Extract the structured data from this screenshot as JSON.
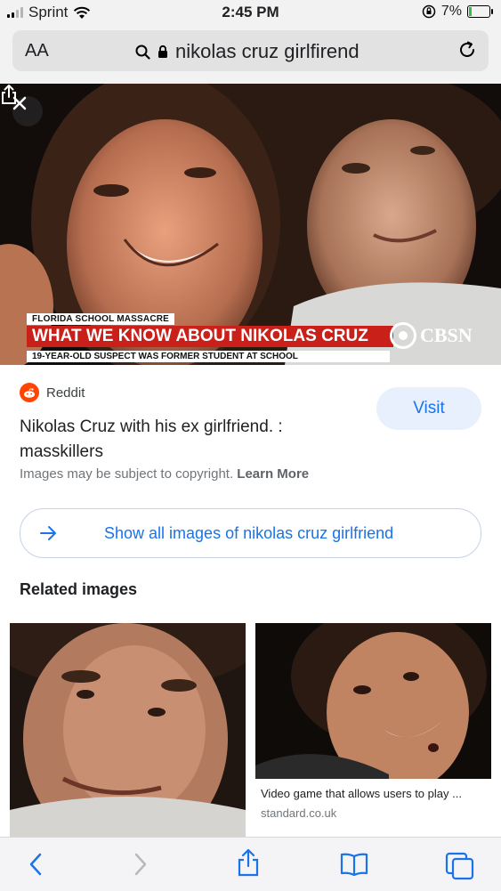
{
  "status_bar": {
    "carrier": "Sprint",
    "time": "2:45 PM",
    "battery_percent": "7%"
  },
  "url_bar": {
    "text_size_label": "AA",
    "query": "nikolas cruz girlfirend"
  },
  "hero": {
    "chyron_top": "FLORIDA SCHOOL MASSACRE",
    "chyron_main": "WHAT WE KNOW ABOUT NIKOLAS CRUZ",
    "chyron_sub": "19-YEAR-OLD SUSPECT WAS FORMER STUDENT AT SCHOOL",
    "network": "CBSN"
  },
  "result": {
    "source": "Reddit",
    "title": "Nikolas Cruz with his ex girlfriend. : masskillers",
    "visit_label": "Visit",
    "copyright_text": "Images may be subject to copyright.",
    "learn_more": "Learn More",
    "show_all_label": "Show all images of nikolas cruz girlfriend"
  },
  "related": {
    "heading": "Related images",
    "items": [
      {
        "caption": "",
        "source": ""
      },
      {
        "caption": "Video game that allows users to play ...",
        "source": "standard.co.uk"
      }
    ]
  },
  "colors": {
    "accent": "#1a73e8",
    "visit_bg": "#e8f0fe",
    "reddit": "#ff4500",
    "chyron_red": "#c9201a"
  },
  "icons": {
    "close": "close-icon",
    "share": "share-icon",
    "back": "chevron-left-icon",
    "forward": "chevron-right-icon",
    "bookmarks": "book-icon",
    "tabs": "tabs-icon"
  }
}
